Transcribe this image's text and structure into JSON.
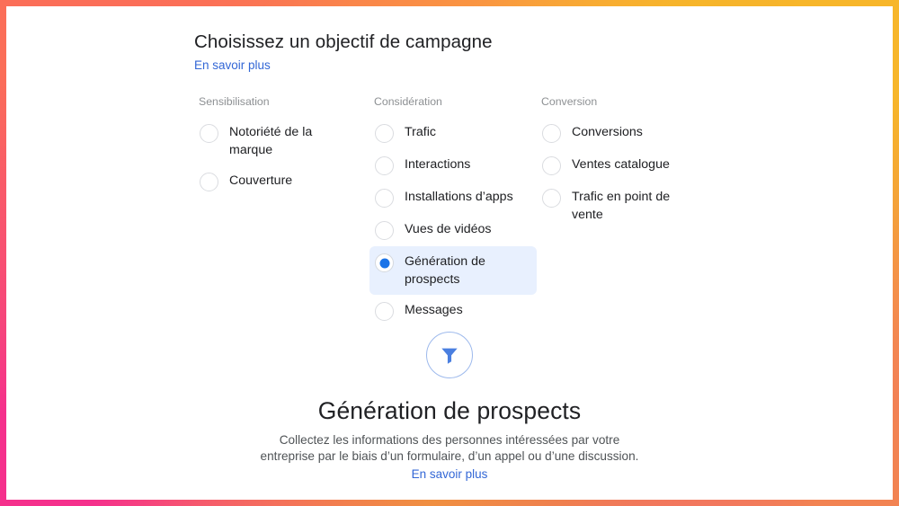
{
  "header": {
    "title": "Choisissez un objectif de campagne",
    "learn_more": "En savoir plus"
  },
  "objectives": {
    "columns": [
      {
        "heading": "Sensibilisation",
        "options": [
          {
            "label": "Notoriété de la marque",
            "selected": false
          },
          {
            "label": "Couverture",
            "selected": false
          }
        ]
      },
      {
        "heading": "Considération",
        "options": [
          {
            "label": "Trafic",
            "selected": false
          },
          {
            "label": "Interactions",
            "selected": false
          },
          {
            "label": "Installations d’apps",
            "selected": false
          },
          {
            "label": "Vues de vidéos",
            "selected": false
          },
          {
            "label": "Génération de prospects",
            "selected": true
          },
          {
            "label": "Messages",
            "selected": false
          }
        ]
      },
      {
        "heading": "Conversion",
        "options": [
          {
            "label": "Conversions",
            "selected": false
          },
          {
            "label": "Ventes catalogue",
            "selected": false
          },
          {
            "label": "Trafic en point de vente",
            "selected": false
          }
        ]
      }
    ]
  },
  "detail": {
    "icon": "funnel-icon",
    "title": "Génération de prospects",
    "description": "Collectez les informations des personnes intéressées par votre entreprise par le biais d’un formulaire, d’un appel ou d’une discussion.",
    "learn_more": "En savoir plus"
  },
  "colors": {
    "accent_blue": "#1a73e8",
    "link_blue": "#3367d6",
    "selected_row_bg": "#e8f0fe",
    "heading_grey": "#8d9093",
    "text_dark": "#202124",
    "radio_border": "#dadce0",
    "border_gradient_top_left": "#fb6e58",
    "border_gradient_top_right": "#f7b62a",
    "border_gradient_bottom_left": "#f5308c",
    "border_gradient_bottom_right": "#f28352"
  }
}
